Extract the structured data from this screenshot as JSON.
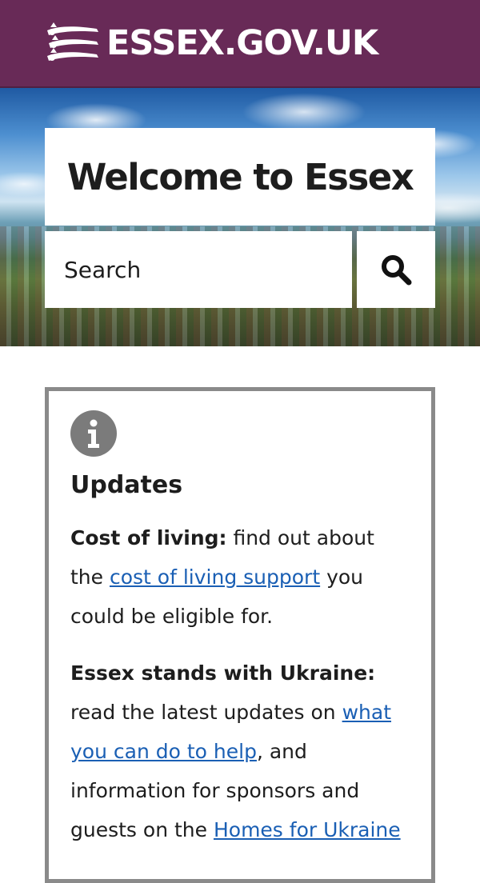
{
  "header": {
    "logo_text": "ESSEX.GOV.UK",
    "logo_icon": "essex-seaxes-icon",
    "background_color": "#682a57"
  },
  "hero": {
    "title": "Welcome to Essex",
    "search": {
      "placeholder": "Search",
      "button_icon": "search-icon"
    }
  },
  "updates": {
    "icon": "info-icon",
    "heading": "Updates",
    "items": [
      {
        "label": "Cost of living:",
        "text_before": " find out about the ",
        "link": "cost of living support",
        "text_after": " you could be eligible for."
      },
      {
        "label": "Essex stands with Ukraine:",
        "text_before": " read the latest updates on ",
        "link": "what you can do to help",
        "text_middle": ", and information for sponsors and guests on the ",
        "link2": "Homes for Ukraine"
      }
    ]
  },
  "colors": {
    "brand_purple": "#682a57",
    "link_blue": "#1a5fb4",
    "box_border": "#8a8a8a"
  }
}
